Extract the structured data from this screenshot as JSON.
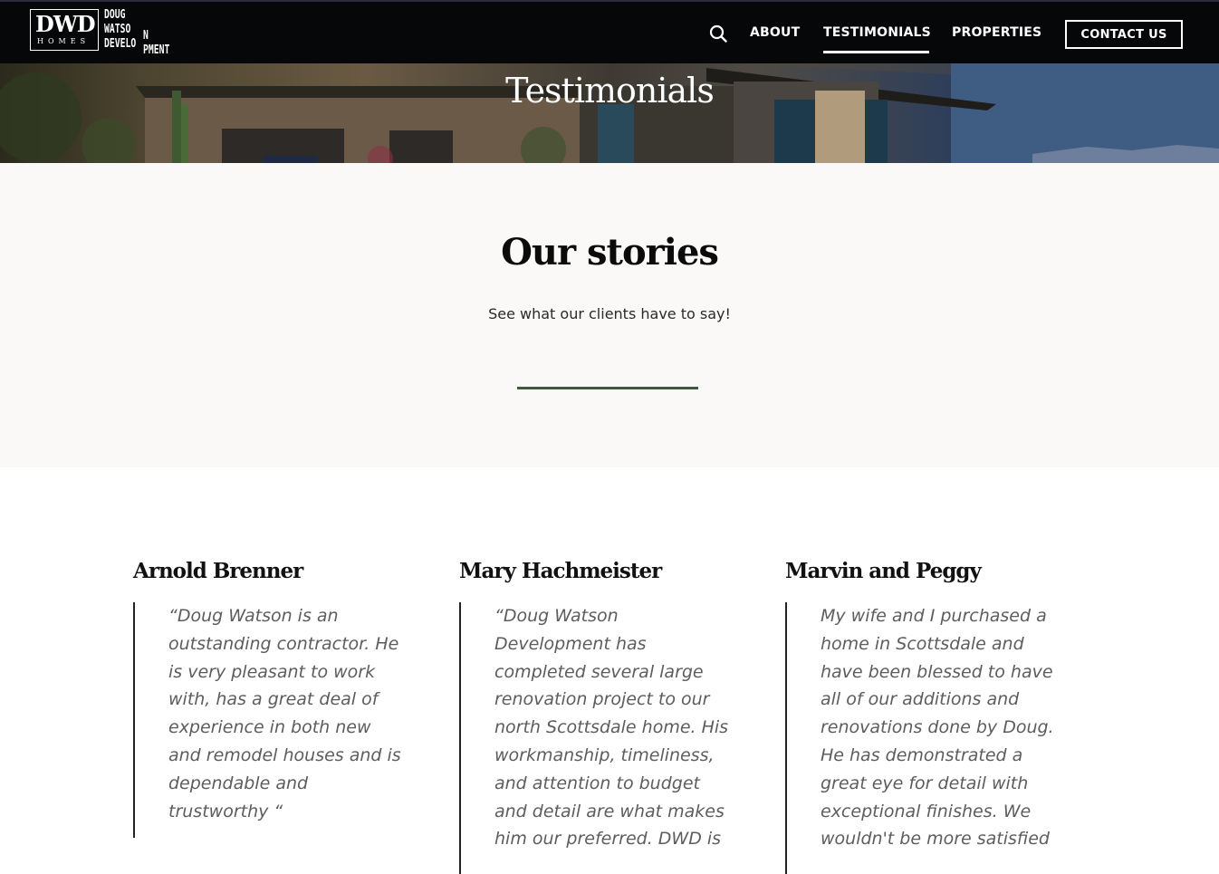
{
  "header": {
    "logo": {
      "mark": "DWD",
      "homes": "HOMES",
      "wordmark_lines": [
        "DOUG",
        "WATSO",
        "DEVELO"
      ],
      "wordmark_tail": [
        "",
        "",
        "N",
        "PMENT"
      ]
    },
    "nav": [
      {
        "label": "ABOUT",
        "active": false
      },
      {
        "label": "TESTIMONIALS",
        "active": true
      },
      {
        "label": "PROPERTIES",
        "active": false
      }
    ],
    "contact_label": "CONTACT US",
    "search_icon": "search-icon"
  },
  "hero": {
    "title": "Testimonials"
  },
  "stories": {
    "heading": "Our stories",
    "subheading": "See what our clients have to say!"
  },
  "testimonials": [
    {
      "name": "Arnold Brenner",
      "quote": "“Doug Watson is an\noutstanding contractor.  He\nis very pleasant to work\nwith, has a great deal of\nexperience in both new\nand remodel houses and is\ndependable and\ntrustworthy “"
    },
    {
      "name": "Mary Hachmeister",
      "quote": " “Doug Watson\nDevelopment has\ncompleted several large\nrenovation project to our\nnorth Scottsdale home. His\nworkmanship, timeliness,\nand attention to budget\nand detail are what makes\nhim our preferred. DWD is"
    },
    {
      "name": "Marvin and Peggy",
      "quote": "My wife and I purchased a\nhome in Scottsdale and\nhave been blessed to have\nall of our additions and\nrenovations done by Doug.\nHe has demonstrated a\ngreat eye for detail with\nexceptional finishes. We\nwouldn't be more satisfied"
    }
  ],
  "colors": {
    "header_bg": "#050708",
    "accent_rule": "#3c5a3c",
    "section_bg": "#faf9f7"
  }
}
